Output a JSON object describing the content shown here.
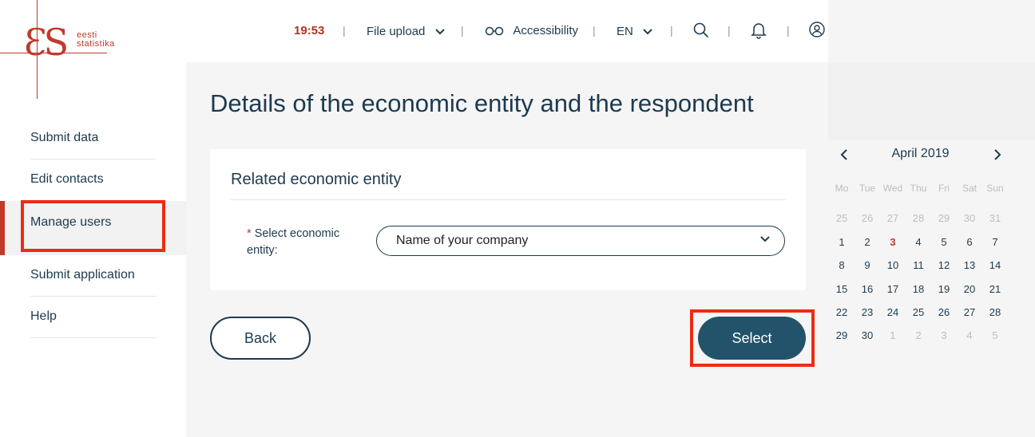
{
  "logo": {
    "mark": "ƐS",
    "line1": "eesti",
    "line2": "statistika"
  },
  "sidebar": {
    "items": [
      {
        "label": "Submit data"
      },
      {
        "label": "Edit contacts"
      },
      {
        "label": "Manage users",
        "active": true
      },
      {
        "label": "Submit application"
      },
      {
        "label": "Help"
      }
    ]
  },
  "header": {
    "time": "19:53",
    "file_upload": "File upload",
    "accessibility": "Accessibility",
    "language": "EN",
    "separator": "|"
  },
  "main": {
    "title": "Details of the economic entity and the respondent",
    "card_title": "Related economic entity",
    "field_required_mark": "*",
    "field_label": "Select economic entity:",
    "select_value": "Name of your company",
    "back_label": "Back",
    "select_label": "Select"
  },
  "calendar": {
    "month": "April 2019",
    "weekdays": [
      "Mo",
      "Tue",
      "Wed",
      "Thu",
      "Fri",
      "Sat",
      "Sun"
    ],
    "weeks": [
      [
        "25",
        "26",
        "27",
        "28",
        "29",
        "30",
        "31"
      ],
      [
        "1",
        "2",
        "3",
        "4",
        "5",
        "6",
        "7"
      ],
      [
        "8",
        "9",
        "10",
        "11",
        "12",
        "13",
        "14"
      ],
      [
        "15",
        "16",
        "17",
        "18",
        "19",
        "20",
        "21"
      ],
      [
        "22",
        "23",
        "24",
        "25",
        "26",
        "27",
        "28"
      ],
      [
        "29",
        "30",
        "1",
        "2",
        "3",
        "4",
        "5"
      ]
    ],
    "today": "3"
  },
  "colors": {
    "accent": "#c0392b",
    "primary": "#22536b",
    "text": "#1d3a4f",
    "highlight": "#ee2b12"
  }
}
